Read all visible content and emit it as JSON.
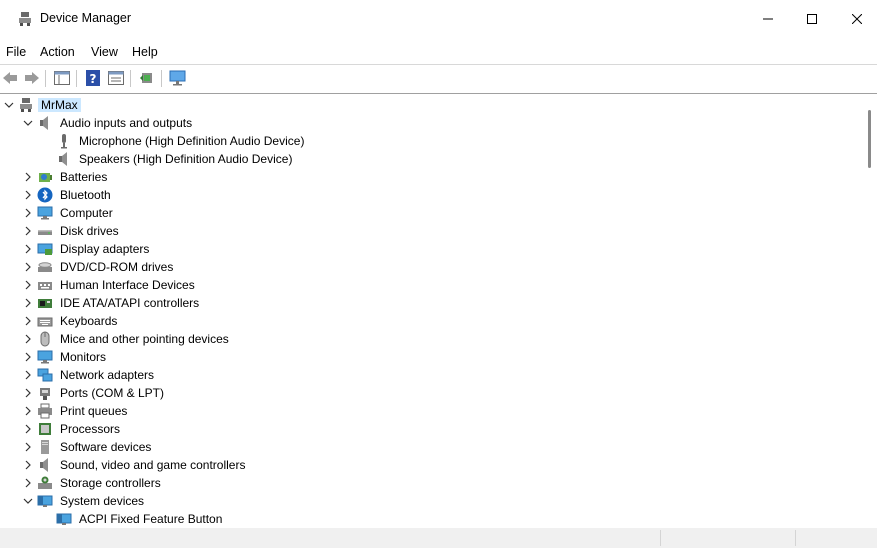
{
  "window": {
    "title": "Device Manager",
    "controls": [
      "minimize",
      "maximize",
      "close"
    ]
  },
  "menu": [
    "File",
    "Action",
    "View",
    "Help"
  ],
  "toolbar": {
    "buttons": [
      "back-icon",
      "forward-icon",
      "properties-panel-icon",
      "help-icon",
      "properties-view-icon",
      "update-driver-icon",
      "scan-hardware-icon"
    ]
  },
  "tree": {
    "root": {
      "label": "MrMax",
      "expanded": true
    },
    "categories": [
      {
        "label": "Audio inputs and outputs",
        "icon": "speaker-icon",
        "expanded": true,
        "children": [
          {
            "label": "Microphone (High Definition Audio Device)",
            "icon": "microphone-icon"
          },
          {
            "label": "Speakers (High Definition Audio Device)",
            "icon": "speaker-icon"
          }
        ]
      },
      {
        "label": "Batteries",
        "icon": "battery-icon",
        "expanded": false
      },
      {
        "label": "Bluetooth",
        "icon": "bluetooth-icon",
        "expanded": false
      },
      {
        "label": "Computer",
        "icon": "monitor-icon",
        "expanded": false
      },
      {
        "label": "Disk drives",
        "icon": "disk-drive-icon",
        "expanded": false
      },
      {
        "label": "Display adapters",
        "icon": "display-adapter-icon",
        "expanded": false
      },
      {
        "label": "DVD/CD-ROM drives",
        "icon": "dvd-drive-icon",
        "expanded": false
      },
      {
        "label": "Human Interface Devices",
        "icon": "hid-icon",
        "expanded": false
      },
      {
        "label": "IDE ATA/ATAPI controllers",
        "icon": "ide-controller-icon",
        "expanded": false
      },
      {
        "label": "Keyboards",
        "icon": "keyboard-icon",
        "expanded": false
      },
      {
        "label": "Mice and other pointing devices",
        "icon": "mouse-icon",
        "expanded": false
      },
      {
        "label": "Monitors",
        "icon": "monitor-icon",
        "expanded": false
      },
      {
        "label": "Network adapters",
        "icon": "network-adapter-icon",
        "expanded": false
      },
      {
        "label": "Ports (COM & LPT)",
        "icon": "port-icon",
        "expanded": false
      },
      {
        "label": "Print queues",
        "icon": "printer-icon",
        "expanded": false
      },
      {
        "label": "Processors",
        "icon": "processor-icon",
        "expanded": false
      },
      {
        "label": "Software devices",
        "icon": "software-device-icon",
        "expanded": false
      },
      {
        "label": "Sound, video and game controllers",
        "icon": "speaker-icon",
        "expanded": false
      },
      {
        "label": "Storage controllers",
        "icon": "storage-controller-icon",
        "expanded": false
      },
      {
        "label": "System devices",
        "icon": "system-devices-icon",
        "expanded": true,
        "children": [
          {
            "label": "ACPI Fixed Feature Button",
            "icon": "system-devices-icon"
          }
        ]
      }
    ]
  },
  "colors": {
    "selection": "#cce8ff",
    "accent": "#0078d7"
  }
}
